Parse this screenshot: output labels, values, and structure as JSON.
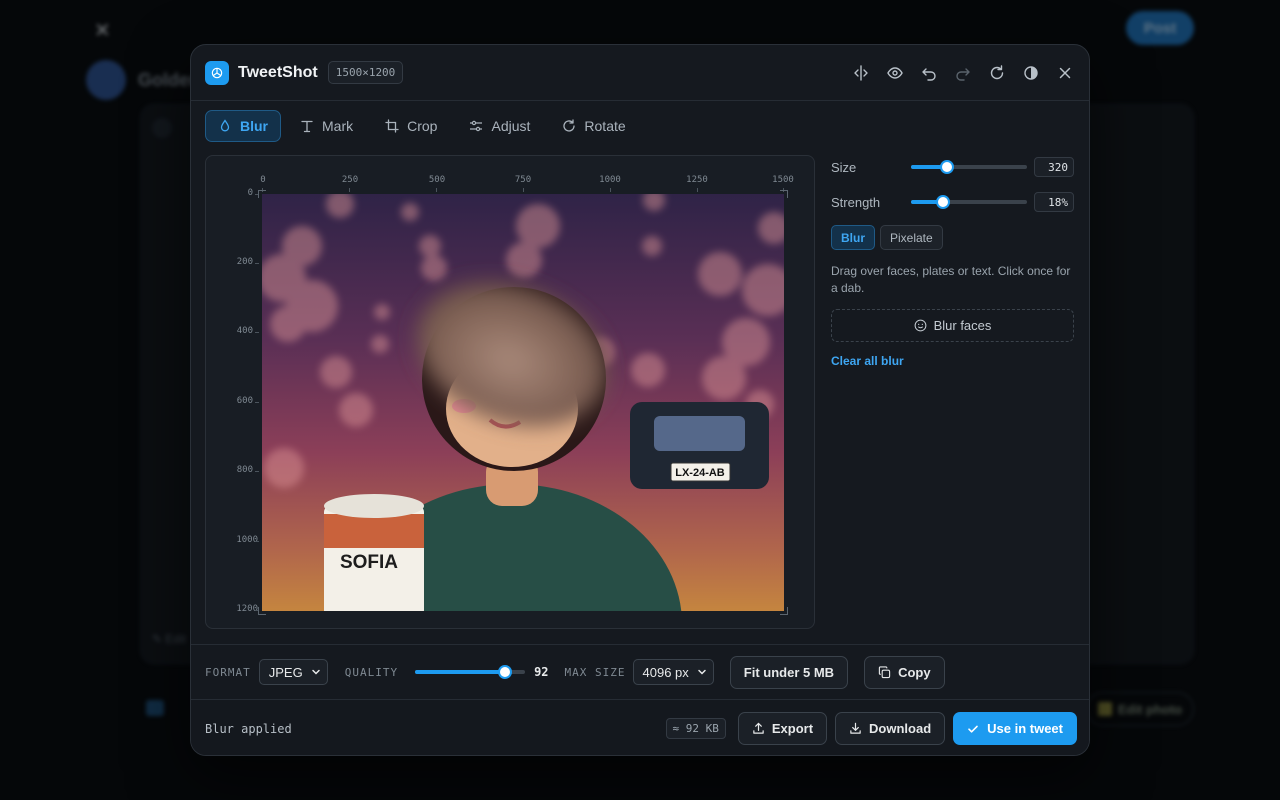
{
  "background": {
    "post_label": "Post",
    "title": "Golden",
    "card_label": "Edit",
    "edit_photo_label": "Edit photo"
  },
  "app": {
    "title": "TweetShot",
    "dimensions": "1500×1200"
  },
  "header_icons": [
    "compare-icon",
    "preview-icon",
    "undo-icon",
    "redo-icon",
    "reset-icon",
    "contrast-icon",
    "close-icon"
  ],
  "tabs": [
    {
      "label": "Blur",
      "icon": "droplet-icon",
      "active": true
    },
    {
      "label": "Mark",
      "icon": "text-icon",
      "active": false
    },
    {
      "label": "Crop",
      "icon": "crop-icon",
      "active": false
    },
    {
      "label": "Adjust",
      "icon": "sliders-icon",
      "active": false
    },
    {
      "label": "Rotate",
      "icon": "rotate-icon",
      "active": false
    }
  ],
  "ruler": {
    "x": [
      "0",
      "250",
      "500",
      "750",
      "1000",
      "1250",
      "1500"
    ],
    "y": [
      "0",
      "200",
      "400",
      "600",
      "800",
      "1000",
      "1200"
    ]
  },
  "image": {
    "plate_text": "LX-24-AB",
    "cup_text": "SOFIA"
  },
  "panel": {
    "size_label": "Size",
    "size_value": "320",
    "size_level": 0.31,
    "strength_label": "Strength",
    "strength_value": "18%",
    "strength_level": 0.28,
    "mode_blur": "Blur",
    "mode_pixelate": "Pixelate",
    "hint": "Drag over faces, plates or text. Click once for a dab.",
    "blur_faces": "Blur faces",
    "clear_all": "Clear all blur"
  },
  "options": {
    "format_label": "FORMAT",
    "format_value": "JPEG",
    "quality_label": "QUALITY",
    "quality_value": "92",
    "quality_level": 0.82,
    "max_size_label": "MAX SIZE",
    "max_size_value": "4096 px",
    "fit_label": "Fit under 5 MB",
    "copy_label": "Copy"
  },
  "footer": {
    "status": "Blur applied",
    "size_estimate": "≈ 92 KB",
    "export_label": "Export",
    "download_label": "Download",
    "use_label": "Use in tweet"
  },
  "colors": {
    "accent": "#1d9bf0",
    "modal_bg": "#15191f"
  }
}
